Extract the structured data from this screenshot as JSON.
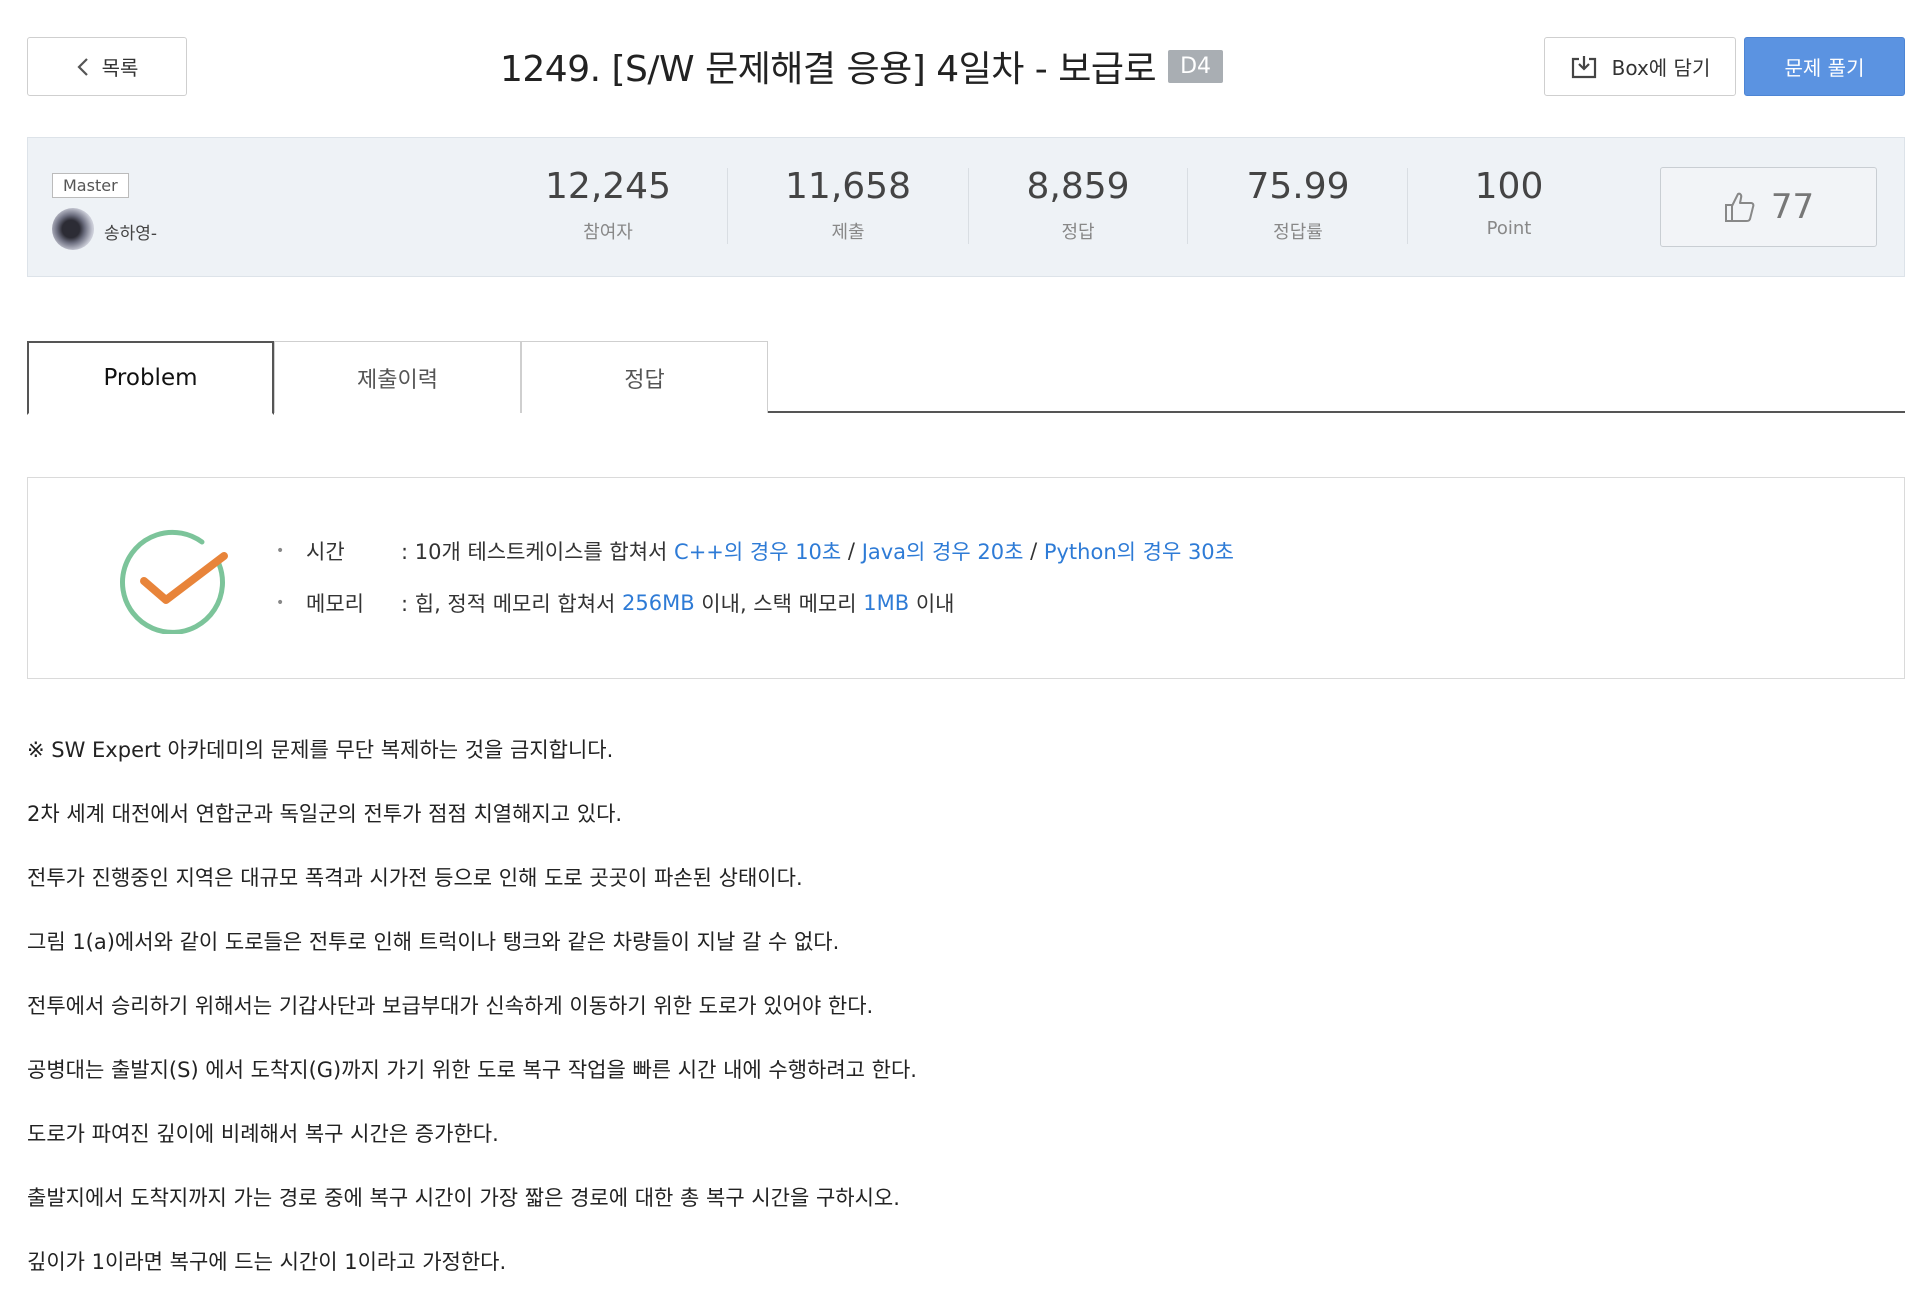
{
  "header": {
    "back_label": "목록",
    "title": "1249. [S/W 문제해결 응용] 4일차 - 보급로",
    "level": "D4",
    "box_label": "Box에 담기",
    "solve_label": "문제 풀기"
  },
  "author": {
    "rank": "Master",
    "name": "송하영-"
  },
  "stats": [
    {
      "value": "12,245",
      "label": "참여자"
    },
    {
      "value": "11,658",
      "label": "제출"
    },
    {
      "value": "8,859",
      "label": "정답"
    },
    {
      "value": "75.99",
      "label": "정답률"
    },
    {
      "value": "100",
      "label": "Point"
    }
  ],
  "likes": "77",
  "tabs": [
    {
      "label": "Problem",
      "active": true
    },
    {
      "label": "제출이력",
      "active": false
    },
    {
      "label": "정답",
      "active": false
    }
  ],
  "limits": {
    "bullet": "•",
    "time": {
      "key": "시간",
      "prefix": ": 10개 테스트케이스를 합쳐서 ",
      "cpp": "C++의 경우 10초",
      "sep1": " / ",
      "java": "Java의 경우 20초",
      "sep2": " / ",
      "python": "Python의 경우 30초"
    },
    "memory": {
      "key": "메모리",
      "prefix": ": 힙, 정적 메모리 합쳐서 ",
      "heap": "256MB",
      "mid": " 이내, 스택 메모리 ",
      "stack": "1MB",
      "suffix": " 이내"
    }
  },
  "description": [
    "※ SW Expert 아카데미의 문제를 무단 복제하는 것을 금지합니다.",
    "2차 세계 대전에서 연합군과 독일군의 전투가 점점 치열해지고 있다.",
    "전투가 진행중인 지역은 대규모 폭격과 시가전 등으로 인해 도로 곳곳이 파손된 상태이다.",
    "그림 1(a)에서와 같이 도로들은 전투로 인해 트럭이나 탱크와 같은 차량들이 지날 갈 수 없다.",
    "전투에서 승리하기 위해서는 기갑사단과 보급부대가 신속하게 이동하기 위한 도로가 있어야 한다.",
    "공병대는 출발지(S) 에서 도착지(G)까지 가기 위한 도로 복구 작업을 빠른 시간 내에 수행하려고 한다.",
    "도로가 파여진 깊이에 비례해서 복구 시간은 증가한다.",
    "출발지에서 도착지까지 가는 경로 중에 복구 시간이 가장 짧은 경로에 대한 총 복구 시간을 구하시오.",
    "깊이가 1이라면 복구에 드는 시간이 1이라고 가정한다."
  ],
  "colors": {
    "primary": "#5b93e1",
    "highlight": "#2e7bd6",
    "check_green": "#7cc49a",
    "check_orange": "#e8843a"
  },
  "icons": [
    "chevron-left-icon",
    "box-download-icon",
    "thumbs-up-icon",
    "check-circle-icon"
  ]
}
